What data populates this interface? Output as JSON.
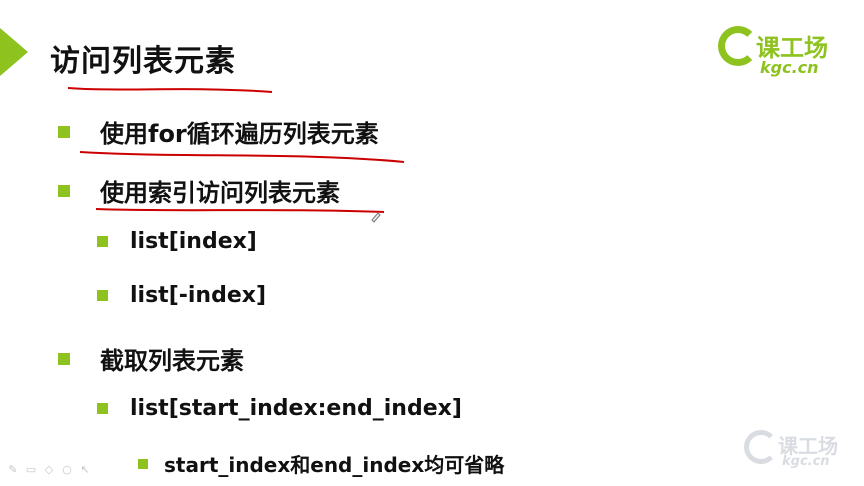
{
  "slide": {
    "title": "访问列表元素",
    "logo": {
      "name": "课工场",
      "sub": "kgc.cn"
    },
    "watermark": {
      "name": "课工场",
      "sub": "kgc.cn"
    },
    "items": [
      {
        "text": "使用for循环遍历列表元素",
        "level": 1
      },
      {
        "text": "使用索引访问列表元素",
        "level": 1
      },
      {
        "text": "list[index]",
        "level": 2
      },
      {
        "text": "list[-index]",
        "level": 2
      },
      {
        "text": "截取列表元素",
        "level": 1
      },
      {
        "text": "list[start_index:end_index]",
        "level": 2
      },
      {
        "text": "start_index和end_index均可省略",
        "level": 3
      }
    ]
  },
  "colors": {
    "accent": "#8dc21f",
    "annotation": "#cc0000"
  },
  "toolbar_icons": [
    "pen-icon",
    "slide-icon",
    "highlighter-icon",
    "eraser-icon",
    "pointer-icon"
  ]
}
